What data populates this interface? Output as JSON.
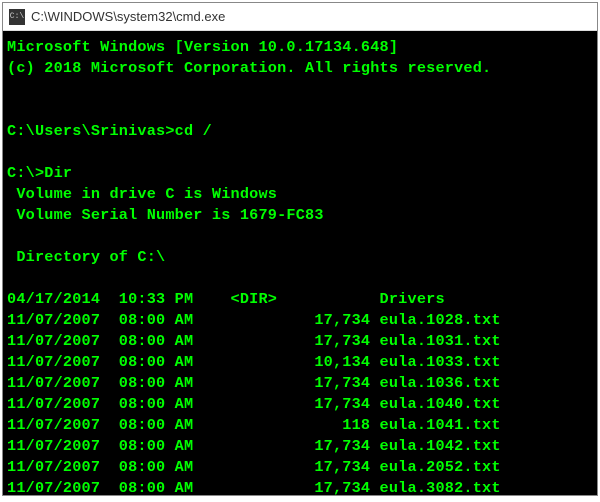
{
  "window": {
    "title": "C:\\WINDOWS\\system32\\cmd.exe",
    "icon_glyph": "C:\\"
  },
  "terminal": {
    "header1": "Microsoft Windows [Version 10.0.17134.648]",
    "header2": "(c) 2018 Microsoft Corporation. All rights reserved.",
    "prompt1": "C:\\Users\\Srinivas>",
    "cmd1": "cd /",
    "prompt2": "C:\\>",
    "cmd2": "Dir",
    "vol_line": " Volume in drive C is Windows",
    "serial_line": " Volume Serial Number is 1679-FC83",
    "dir_of": " Directory of C:\\",
    "entries": [
      {
        "date": "04/17/2014",
        "time": "10:33 PM",
        "type": "<DIR>",
        "size": "",
        "name": "Drivers"
      },
      {
        "date": "11/07/2007",
        "time": "08:00 AM",
        "type": "",
        "size": "17,734",
        "name": "eula.1028.txt"
      },
      {
        "date": "11/07/2007",
        "time": "08:00 AM",
        "type": "",
        "size": "17,734",
        "name": "eula.1031.txt"
      },
      {
        "date": "11/07/2007",
        "time": "08:00 AM",
        "type": "",
        "size": "10,134",
        "name": "eula.1033.txt"
      },
      {
        "date": "11/07/2007",
        "time": "08:00 AM",
        "type": "",
        "size": "17,734",
        "name": "eula.1036.txt"
      },
      {
        "date": "11/07/2007",
        "time": "08:00 AM",
        "type": "",
        "size": "17,734",
        "name": "eula.1040.txt"
      },
      {
        "date": "11/07/2007",
        "time": "08:00 AM",
        "type": "",
        "size": "118",
        "name": "eula.1041.txt"
      },
      {
        "date": "11/07/2007",
        "time": "08:00 AM",
        "type": "",
        "size": "17,734",
        "name": "eula.1042.txt"
      },
      {
        "date": "11/07/2007",
        "time": "08:00 AM",
        "type": "",
        "size": "17,734",
        "name": "eula.2052.txt"
      },
      {
        "date": "11/07/2007",
        "time": "08:00 AM",
        "type": "",
        "size": "17,734",
        "name": "eula.3082.txt"
      }
    ]
  }
}
